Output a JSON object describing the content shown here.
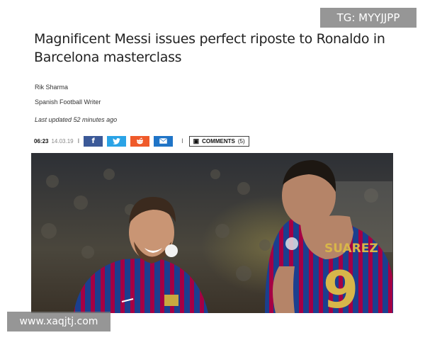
{
  "article": {
    "headline": "Magnificent Messi issues perfect riposte to Ronaldo in Barcelona masterclass",
    "author": "Rik Sharma",
    "author_role": "Spanish Football Writer",
    "last_updated": "Last updated 52 minutes ago"
  },
  "sharebar": {
    "time": "06:23",
    "date": "14.03.19",
    "separator": "I",
    "facebook_icon": "f",
    "twitter_icon": "twitter-bird",
    "reddit_icon": "reddit-alien",
    "email_icon": "envelope",
    "comments_label": "COMMENTS",
    "comments_count": "(5)"
  },
  "photo": {
    "jersey_name": "SUAREZ",
    "jersey_number": "9"
  },
  "watermarks": {
    "top_right": "TG: MYYJJPP",
    "bottom_left": "www.xaqjtj.com"
  },
  "colors": {
    "facebook": "#3b5998",
    "twitter": "#2aa3e6",
    "reddit": "#ef5a2a",
    "email": "#1f74c7",
    "barca_blue": "#1b3f8f",
    "barca_red": "#a50044"
  }
}
